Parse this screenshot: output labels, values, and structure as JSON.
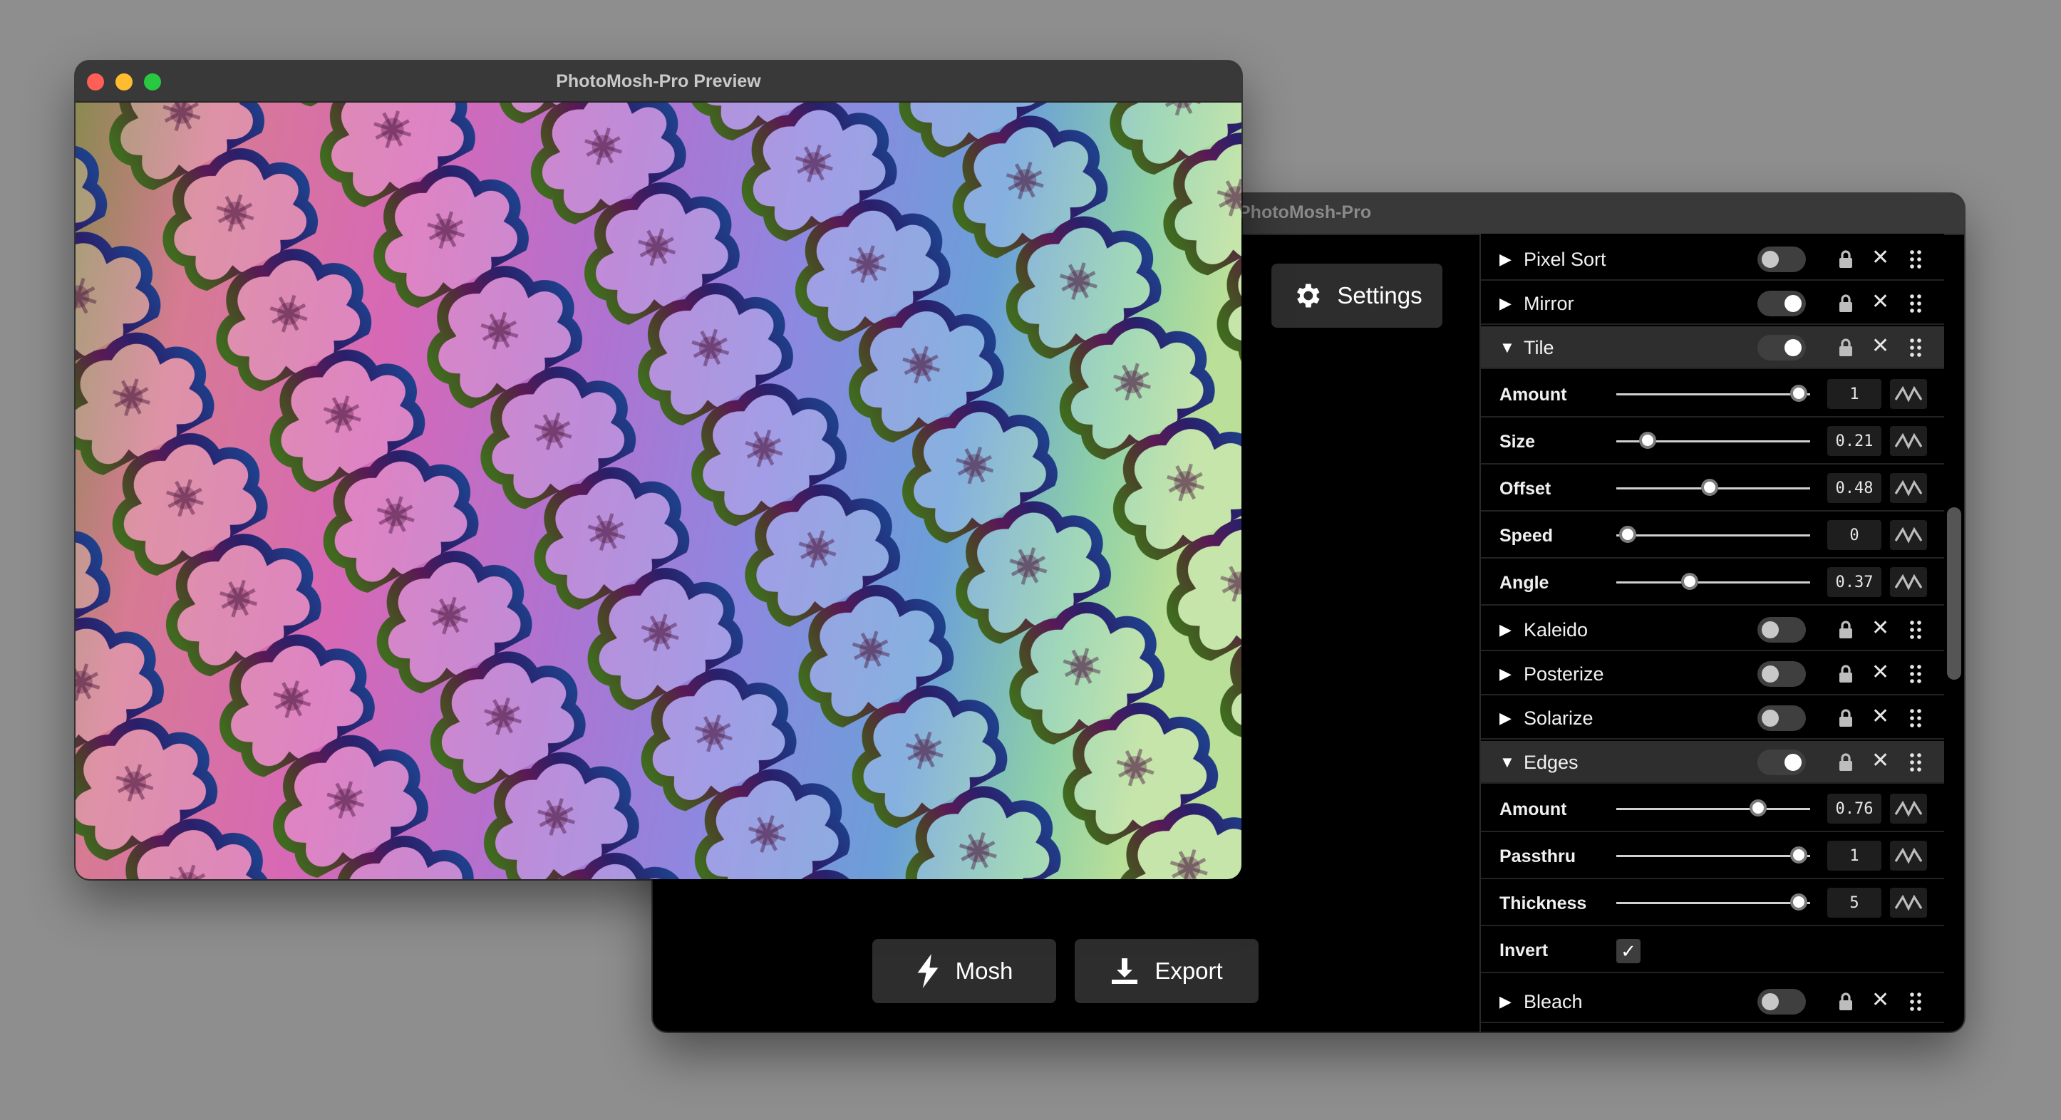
{
  "main_window": {
    "title": "PhotoMosh-Pro",
    "settings_label": "Settings",
    "mosh_label": "Mosh",
    "export_label": "Export"
  },
  "preview_window": {
    "title": "PhotoMosh-Pro Preview"
  },
  "effects": [
    {
      "name": "Pixel Sort",
      "enabled": false,
      "expanded": false
    },
    {
      "name": "Mirror",
      "enabled": true,
      "expanded": false
    },
    {
      "name": "Tile",
      "enabled": true,
      "expanded": true,
      "params": [
        {
          "label": "Amount",
          "value": "1",
          "fraction": 0.94
        },
        {
          "label": "Size",
          "value": "0.21",
          "fraction": 0.16
        },
        {
          "label": "Offset",
          "value": "0.48",
          "fraction": 0.48
        },
        {
          "label": "Speed",
          "value": "0",
          "fraction": 0.06
        },
        {
          "label": "Angle",
          "value": "0.37",
          "fraction": 0.38
        }
      ]
    },
    {
      "name": "Kaleido",
      "enabled": false,
      "expanded": false
    },
    {
      "name": "Posterize",
      "enabled": false,
      "expanded": false
    },
    {
      "name": "Solarize",
      "enabled": false,
      "expanded": false
    },
    {
      "name": "Edges",
      "enabled": true,
      "expanded": true,
      "params": [
        {
          "label": "Amount",
          "value": "0.76",
          "fraction": 0.73
        },
        {
          "label": "Passthru",
          "value": "1",
          "fraction": 0.94
        },
        {
          "label": "Thickness",
          "value": "5",
          "fraction": 0.94
        }
      ],
      "invert": {
        "label": "Invert",
        "checked": true
      }
    },
    {
      "name": "Bleach",
      "enabled": false,
      "expanded": false
    }
  ],
  "icons": {
    "expand_closed": "triangle-right-icon",
    "expand_open": "triangle-down-icon",
    "lock": "lock-icon",
    "delete": "close-icon",
    "drag": "drag-handle-icon",
    "modulate": "wave-icon",
    "settings": "gear-icon",
    "mosh": "lightning-icon",
    "export": "download-icon"
  },
  "colors": {
    "traffic_close": "#ff5f57",
    "traffic_minimize": "#febc2e",
    "traffic_zoom": "#28c840"
  }
}
